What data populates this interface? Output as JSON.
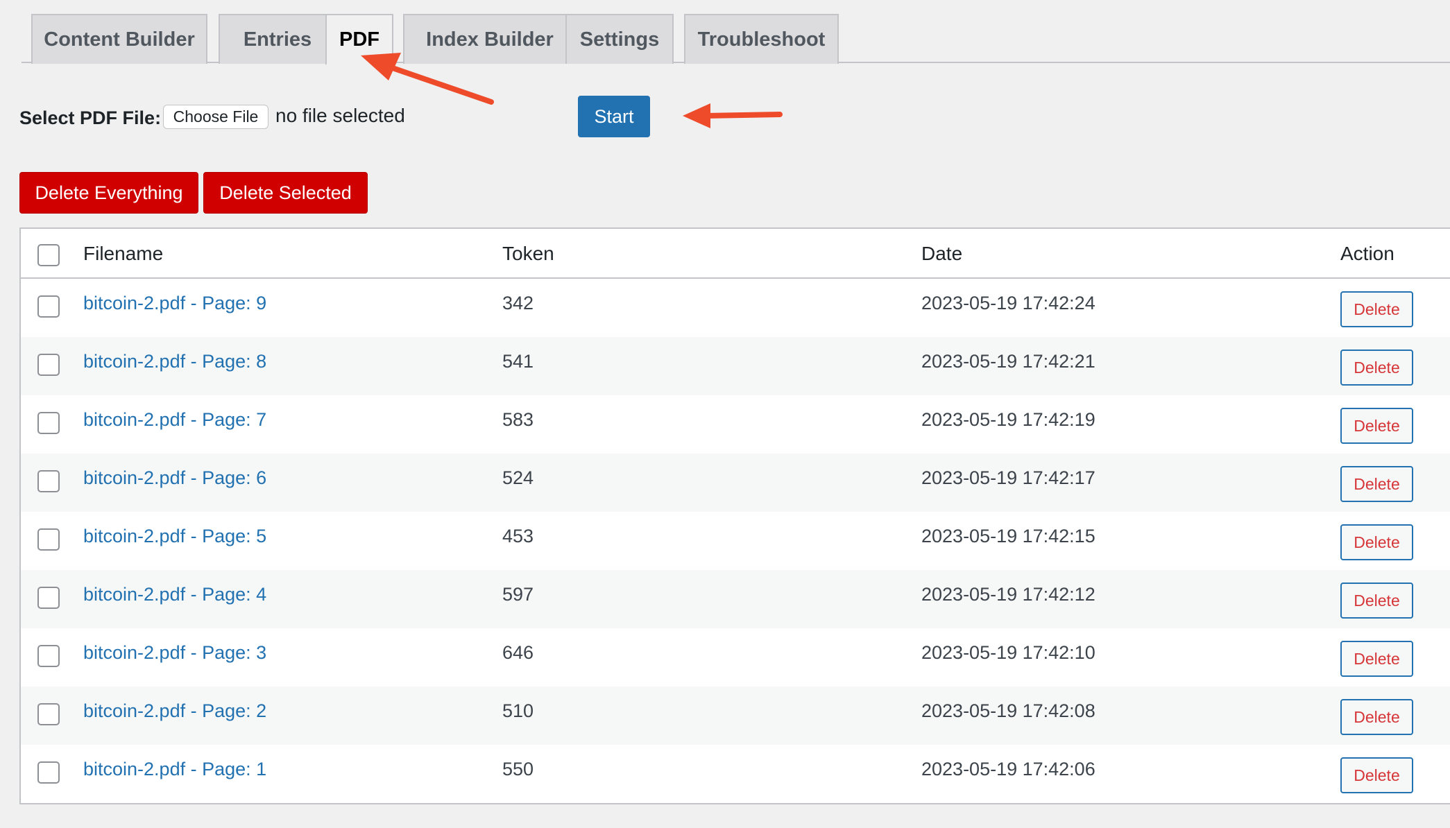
{
  "tabs": [
    {
      "label": "Content Builder",
      "active": false
    },
    {
      "label": "Entries",
      "active": false
    },
    {
      "label": "PDF",
      "active": true
    },
    {
      "label": "Index Builder",
      "active": false
    },
    {
      "label": "Settings",
      "active": false
    },
    {
      "label": "Troubleshoot",
      "active": false
    }
  ],
  "file_select": {
    "label": "Select PDF File:",
    "button_label": "Choose File",
    "status": "no file selected"
  },
  "start_label": "Start",
  "bulk": {
    "delete_everything": "Delete Everything",
    "delete_selected": "Delete Selected"
  },
  "table": {
    "headers": [
      "Filename",
      "Token",
      "Date",
      "Action"
    ],
    "rows": [
      {
        "filename": "bitcoin-2.pdf - Page: 9",
        "token": "342",
        "date": "2023-05-19 17:42:24",
        "action": "Delete"
      },
      {
        "filename": "bitcoin-2.pdf - Page: 8",
        "token": "541",
        "date": "2023-05-19 17:42:21",
        "action": "Delete"
      },
      {
        "filename": "bitcoin-2.pdf - Page: 7",
        "token": "583",
        "date": "2023-05-19 17:42:19",
        "action": "Delete"
      },
      {
        "filename": "bitcoin-2.pdf - Page: 6",
        "token": "524",
        "date": "2023-05-19 17:42:17",
        "action": "Delete"
      },
      {
        "filename": "bitcoin-2.pdf - Page: 5",
        "token": "453",
        "date": "2023-05-19 17:42:15",
        "action": "Delete"
      },
      {
        "filename": "bitcoin-2.pdf - Page: 4",
        "token": "597",
        "date": "2023-05-19 17:42:12",
        "action": "Delete"
      },
      {
        "filename": "bitcoin-2.pdf - Page: 3",
        "token": "646",
        "date": "2023-05-19 17:42:10",
        "action": "Delete"
      },
      {
        "filename": "bitcoin-2.pdf - Page: 2",
        "token": "510",
        "date": "2023-05-19 17:42:08",
        "action": "Delete"
      },
      {
        "filename": "bitcoin-2.pdf - Page: 1",
        "token": "550",
        "date": "2023-05-19 17:42:06",
        "action": "Delete"
      }
    ]
  },
  "colors": {
    "primary": "#2271b1",
    "danger": "#d10000",
    "annotation_arrow": "#ee4b2b"
  },
  "icons": {
    "annotation": "arrow-icon"
  }
}
